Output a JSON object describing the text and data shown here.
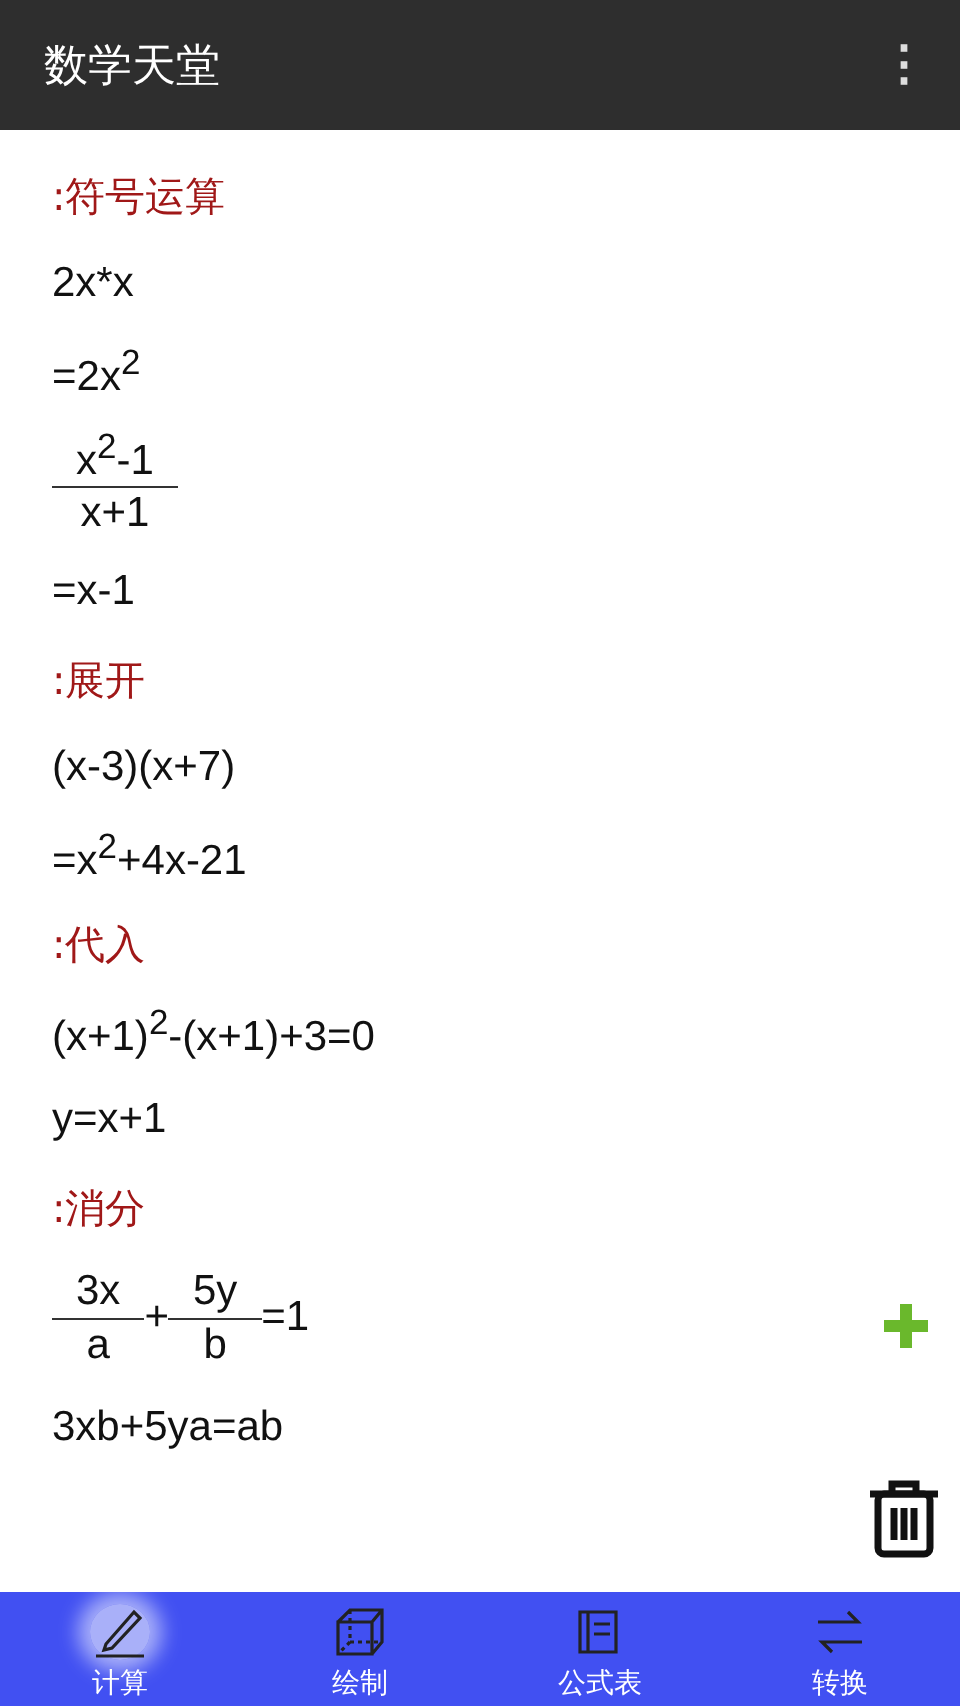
{
  "app_bar": {
    "title": "数学天堂",
    "menu": "⋮"
  },
  "lines": [
    {
      "kind": "heading",
      "text": ":符号运算"
    },
    {
      "kind": "math",
      "parts": [
        {
          "kind": "text",
          "text": "2x*x"
        }
      ]
    },
    {
      "kind": "math",
      "parts": [
        {
          "kind": "text",
          "text": "=2x$^{2}$"
        }
      ]
    },
    {
      "kind": "math",
      "parts": [
        {
          "kind": "frac",
          "num": "x$^{2}$-1",
          "den": "x+1"
        }
      ]
    },
    {
      "kind": "math",
      "parts": [
        {
          "kind": "text",
          "text": "=x-1"
        }
      ]
    },
    {
      "kind": "heading",
      "text": ":展开"
    },
    {
      "kind": "math",
      "parts": [
        {
          "kind": "text",
          "text": "(x-3)(x+7)"
        }
      ]
    },
    {
      "kind": "math",
      "parts": [
        {
          "kind": "text",
          "text": "=x$^{2}$+4x-21"
        }
      ]
    },
    {
      "kind": "heading",
      "text": ":代入"
    },
    {
      "kind": "math",
      "parts": [
        {
          "kind": "text",
          "text": "(x+1)$^{2}$-(x+1)+3=0"
        }
      ]
    },
    {
      "kind": "math",
      "parts": [
        {
          "kind": "text",
          "text": "y=x+1"
        }
      ]
    },
    {
      "kind": "heading",
      "text": ":消分"
    },
    {
      "kind": "math",
      "parts": [
        {
          "kind": "frac",
          "num": "3x",
          "den": "a"
        },
        {
          "kind": "text",
          "text": "+"
        },
        {
          "kind": "frac",
          "num": "5y",
          "den": "b"
        },
        {
          "kind": "text",
          "text": "=1"
        }
      ]
    },
    {
      "kind": "math",
      "parts": [
        {
          "kind": "text",
          "text": "3xb+5ya=ab"
        }
      ]
    }
  ],
  "tabs": [
    {
      "label": "计算",
      "selected": true
    },
    {
      "label": "绘制",
      "selected": false
    },
    {
      "label": "公式表",
      "selected": false
    },
    {
      "label": "转换",
      "selected": false
    }
  ]
}
